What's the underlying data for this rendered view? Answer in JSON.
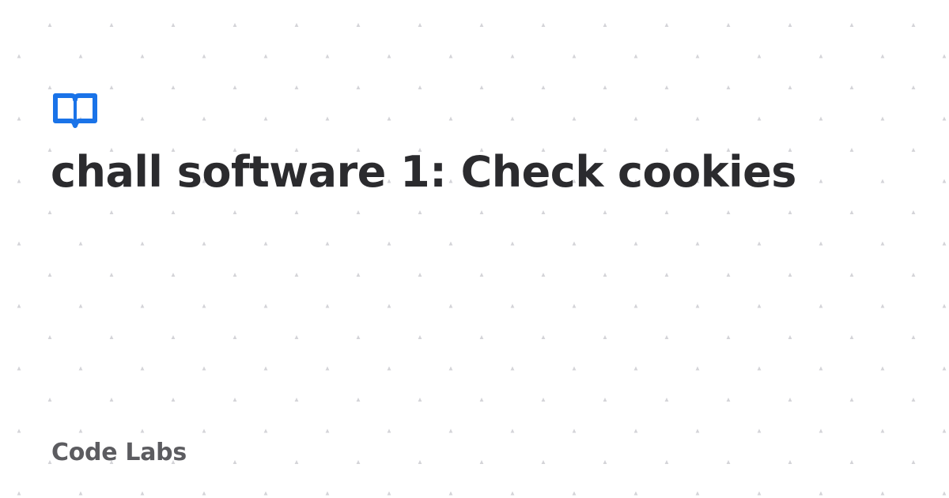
{
  "card": {
    "title": "chall software 1: Check cookies",
    "brand": "Code Labs",
    "logo_icon": "open-book-icon"
  },
  "colors": {
    "accent": "#1a73e8",
    "title": "#2b2b2e",
    "brand": "#5c5c60",
    "background": "#ffffff",
    "dot": "#d4d4d8"
  }
}
